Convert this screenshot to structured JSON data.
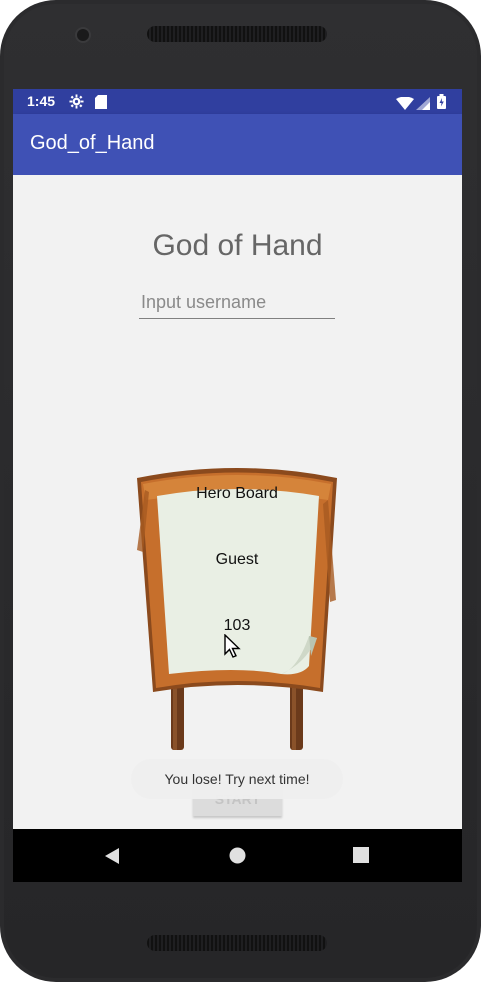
{
  "status_bar": {
    "time": "1:45",
    "icons": [
      "gear-icon",
      "sd-card-icon",
      "wifi-icon",
      "signal-icon",
      "battery-icon"
    ],
    "background": "#303f9f"
  },
  "app_bar": {
    "title": "God_of_Hand",
    "background": "#3f51b5"
  },
  "main": {
    "game_title": "God of Hand",
    "username_input": {
      "value": "",
      "placeholder": "Input username"
    },
    "hero_board": {
      "title": "Hero Board",
      "player": "Guest",
      "score": "103"
    },
    "start_button": {
      "label": "START"
    },
    "toast": {
      "message": "You lose! Try next time!"
    }
  },
  "navigation_bar": {
    "buttons": [
      "back-icon",
      "home-icon",
      "recents-icon"
    ]
  }
}
